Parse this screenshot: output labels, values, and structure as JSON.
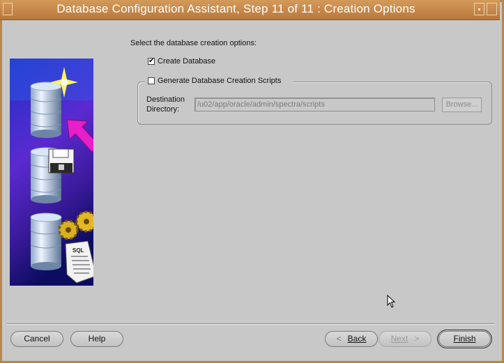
{
  "window": {
    "title": "Database Configuration Assistant, Step 11 of 11 : Creation Options"
  },
  "main": {
    "prompt": "Select the database creation options:",
    "create_database": {
      "label": "Create Database",
      "checked": true
    },
    "generate_scripts": {
      "label": "Generate Database Creation Scripts",
      "checked": false
    },
    "destination": {
      "label_line1": "Destination",
      "label_line2": "Directory:",
      "value": "/u02/app/oracle/admin/spectra/scripts"
    },
    "browse_label": "Browse..."
  },
  "illustration": {
    "icons": [
      "database-star-icon",
      "arrow-icon",
      "floppy-disk-icon",
      "gears-icon",
      "sql-script-icon"
    ],
    "sql_text": "SQL"
  },
  "footer": {
    "cancel_label": "Cancel",
    "help_label": "Help",
    "back_label": "Back",
    "next_label": "Next",
    "finish_label": "Finish"
  },
  "colors": {
    "titlebar": "#c8894b",
    "background": "#c8c8c8",
    "arrow": "#e81ec8"
  }
}
